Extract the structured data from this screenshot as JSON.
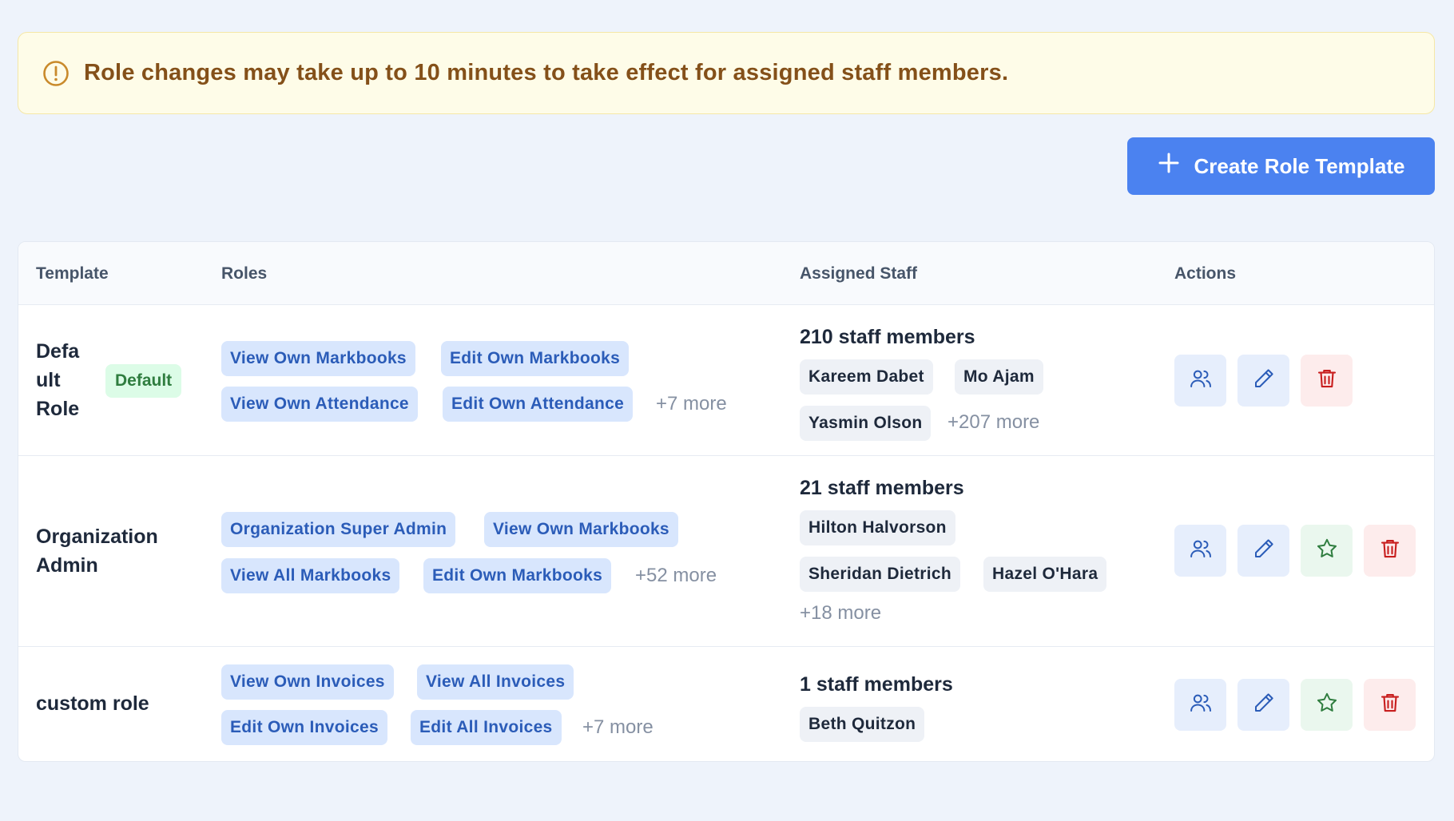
{
  "notice": {
    "icon": "alert-circle-icon",
    "text": "Role changes may take up to 10 minutes to take effect for assigned staff members."
  },
  "create_button": {
    "icon": "plus-icon",
    "label": "Create Role Template"
  },
  "table": {
    "headers": {
      "template": "Template",
      "roles": "Roles",
      "assigned_staff": "Assigned Staff",
      "actions": "Actions"
    },
    "rows": [
      {
        "name_lines": [
          "Defa",
          "ult",
          "Role"
        ],
        "badge": "Default",
        "roles": [
          "View Own Markbooks",
          "Edit Own Markbooks",
          "View Own Attendance",
          "Edit Own Attendance"
        ],
        "roles_more": "+7 more",
        "staff_count": "210 staff members",
        "staff": [
          "Kareem Dabet",
          "Mo Ajam",
          "Yasmin Olson"
        ],
        "staff_more": "+207 more",
        "actions": [
          "users-icon",
          "pencil-icon",
          "trash-icon"
        ]
      },
      {
        "name_lines": [
          "Organization",
          "Admin"
        ],
        "badge": "",
        "roles": [
          "Organization Super Admin",
          "View Own Markbooks",
          "View All Markbooks",
          "Edit Own Markbooks"
        ],
        "roles_more": "+52 more",
        "staff_count": "21 staff members",
        "staff": [
          "Hilton Halvorson",
          "Sheridan Dietrich",
          "Hazel O'Hara"
        ],
        "staff_more": "+18 more",
        "actions": [
          "users-icon",
          "pencil-icon",
          "star-icon",
          "trash-icon"
        ]
      },
      {
        "name_lines": [
          "custom role"
        ],
        "badge": "",
        "roles": [
          "View Own Invoices",
          "View All Invoices",
          "Edit Own Invoices",
          "Edit All Invoices"
        ],
        "roles_more": "+7 more",
        "staff_count": "1 staff members",
        "staff": [
          "Beth Quitzon"
        ],
        "staff_more": "",
        "actions": [
          "users-icon",
          "pencil-icon",
          "star-icon",
          "trash-icon"
        ]
      }
    ]
  },
  "colors": {
    "primary": "#4b82f0",
    "notice_bg": "#fefce8",
    "notice_text": "#845019",
    "role_chip_bg": "#d8e6fd",
    "role_chip_text": "#2b5cb8",
    "default_badge_bg": "#dcfce7",
    "default_badge_text": "#2f7d3f",
    "danger": "#c81e1e",
    "success": "#2f7d3f"
  }
}
